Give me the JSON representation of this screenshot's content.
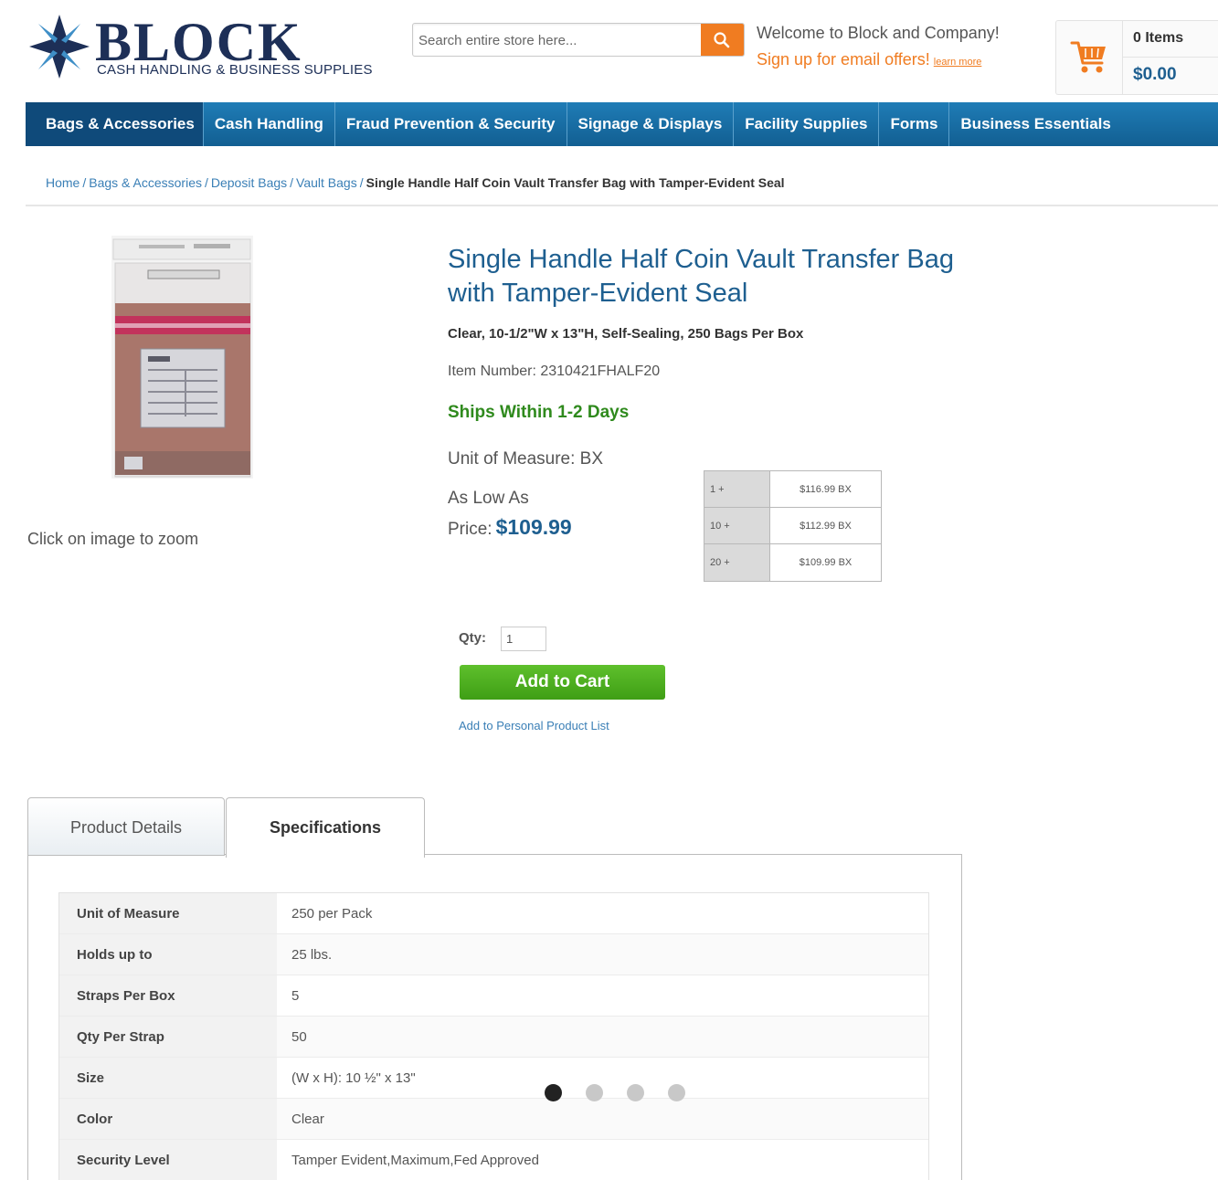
{
  "brand": {
    "name": "BLOCK",
    "tagline": "CASH HANDLING & BUSINESS SUPPLIES",
    "navy": "#1d2f57",
    "accent_orange": "#f07c21",
    "link_blue": "#1e5f90"
  },
  "search": {
    "placeholder": "Search entire store here...",
    "button_icon": "search-icon"
  },
  "welcome": {
    "line1": "Welcome to Block and Company!",
    "line2": "Sign up for email offers!",
    "learn_more": "learn more"
  },
  "cart": {
    "icon": "shopping-cart-icon",
    "items": "0 Items",
    "total": "$0.00"
  },
  "nav": {
    "items": [
      {
        "label": "Bags & Accessories"
      },
      {
        "label": "Cash Handling"
      },
      {
        "label": "Fraud Prevention & Security"
      },
      {
        "label": "Signage & Displays"
      },
      {
        "label": "Facility Supplies"
      },
      {
        "label": "Forms"
      },
      {
        "label": "Business Essentials"
      }
    ]
  },
  "breadcrumb": {
    "items": [
      "Home",
      "Bags & Accessories",
      "Deposit Bags",
      "Vault Bags"
    ],
    "current": "Single Handle Half Coin Vault Transfer Bag with Tamper-Evident Seal"
  },
  "product": {
    "zoom_note": "Click on image to zoom",
    "title": "Single Handle Half Coin Vault Transfer Bag with Tamper-Evident Seal",
    "subtitle": "Clear, 10-1/2\"W x 13\"H, Self-Sealing, 250 Bags Per Box",
    "item_number": "Item Number: 2310421FHALF20",
    "ships": "Ships Within 1-2 Days",
    "unit_of_measure": "Unit of Measure: BX",
    "low_as": "As Low As",
    "price_label": "Price:",
    "price": "$109.99",
    "tiers": [
      {
        "qty": "1 +",
        "price": "$116.99 BX"
      },
      {
        "qty": "10 +",
        "price": "$112.99 BX"
      },
      {
        "qty": "20 +",
        "price": "$109.99 BX"
      }
    ],
    "qty_label": "Qty:",
    "qty_value": "1",
    "add_to_cart": "Add to Cart",
    "personal_list": "Add to Personal Product List"
  },
  "tabs": {
    "details": "Product Details",
    "specs": "Specifications",
    "active": "Specifications"
  },
  "specs": [
    {
      "label": "Unit of Measure",
      "value": "250 per Pack"
    },
    {
      "label": "Holds up to",
      "value": "25 lbs."
    },
    {
      "label": "Straps Per Box",
      "value": "5"
    },
    {
      "label": "Qty Per Strap",
      "value": "50"
    },
    {
      "label": "Size",
      "value": "(W x H): 10 ½\" x 13\""
    },
    {
      "label": "Color",
      "value": "Clear"
    },
    {
      "label": "Security Level",
      "value": "Tamper Evident,Maximum,Fed Approved"
    }
  ],
  "carousel": {
    "count": 4,
    "active_index": 0
  }
}
